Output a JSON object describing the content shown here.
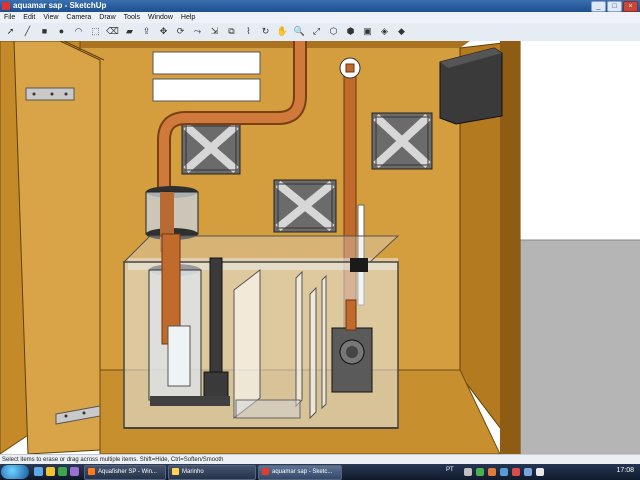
{
  "window": {
    "title": "aquamar sap - SketchUp"
  },
  "window_buttons": [
    "_",
    "□",
    "×"
  ],
  "menu": [
    "File",
    "Edit",
    "View",
    "Camera",
    "Draw",
    "Tools",
    "Window",
    "Help"
  ],
  "tools": [
    {
      "name": "select-tool-icon",
      "glyph": "➚"
    },
    {
      "name": "line-tool-icon",
      "glyph": "╱"
    },
    {
      "name": "rectangle-tool-icon",
      "glyph": "■"
    },
    {
      "name": "circle-tool-icon",
      "glyph": "●"
    },
    {
      "name": "arc-tool-icon",
      "glyph": "◠"
    },
    {
      "name": "make-component-icon",
      "glyph": "⬚"
    },
    {
      "name": "eraser-tool-icon",
      "glyph": "⌫"
    },
    {
      "name": "paint-bucket-icon",
      "glyph": "▰"
    },
    {
      "name": "push-pull-icon",
      "glyph": "⇪"
    },
    {
      "name": "move-tool-icon",
      "glyph": "✥"
    },
    {
      "name": "rotate-tool-icon",
      "glyph": "⟳"
    },
    {
      "name": "follow-me-icon",
      "glyph": "⤳"
    },
    {
      "name": "scale-tool-icon",
      "glyph": "⇲"
    },
    {
      "name": "offset-tool-icon",
      "glyph": "⧉"
    },
    {
      "name": "tape-measure-icon",
      "glyph": "⌇"
    },
    {
      "name": "orbit-tool-icon",
      "glyph": "↻"
    },
    {
      "name": "pan-tool-icon",
      "glyph": "✋"
    },
    {
      "name": "zoom-tool-icon",
      "glyph": "🔍"
    },
    {
      "name": "zoom-extents-icon",
      "glyph": "⤢"
    },
    {
      "name": "get-models-icon",
      "glyph": "⬡"
    },
    {
      "name": "share-model-icon",
      "glyph": "⬢"
    },
    {
      "name": "components-icon",
      "glyph": "▣"
    },
    {
      "name": "materials-icon",
      "glyph": "◈"
    },
    {
      "name": "styles-icon",
      "glyph": "◆"
    }
  ],
  "status": {
    "text": "Select items to erase or drag across multiple items. Shift=Hide, Ctrl=Soften/Smooth"
  },
  "taskbar": {
    "tasks": [
      {
        "label": "Aquafisher SP - Win...",
        "color": "#ff7a1a"
      },
      {
        "label": "Marinho",
        "color": "#ffd34d"
      },
      {
        "label": "aquamar sap - Sketc...",
        "color": "#e23c2c"
      }
    ],
    "language": "PT",
    "clock": "17:08"
  },
  "colors": {
    "wood": "#d09a3a",
    "wood_dark": "#b67d22",
    "pipe": "#c06a2c",
    "glass": "#dfe7ee",
    "speaker": "#3b3b3b",
    "vent": "#6a6a6a"
  }
}
